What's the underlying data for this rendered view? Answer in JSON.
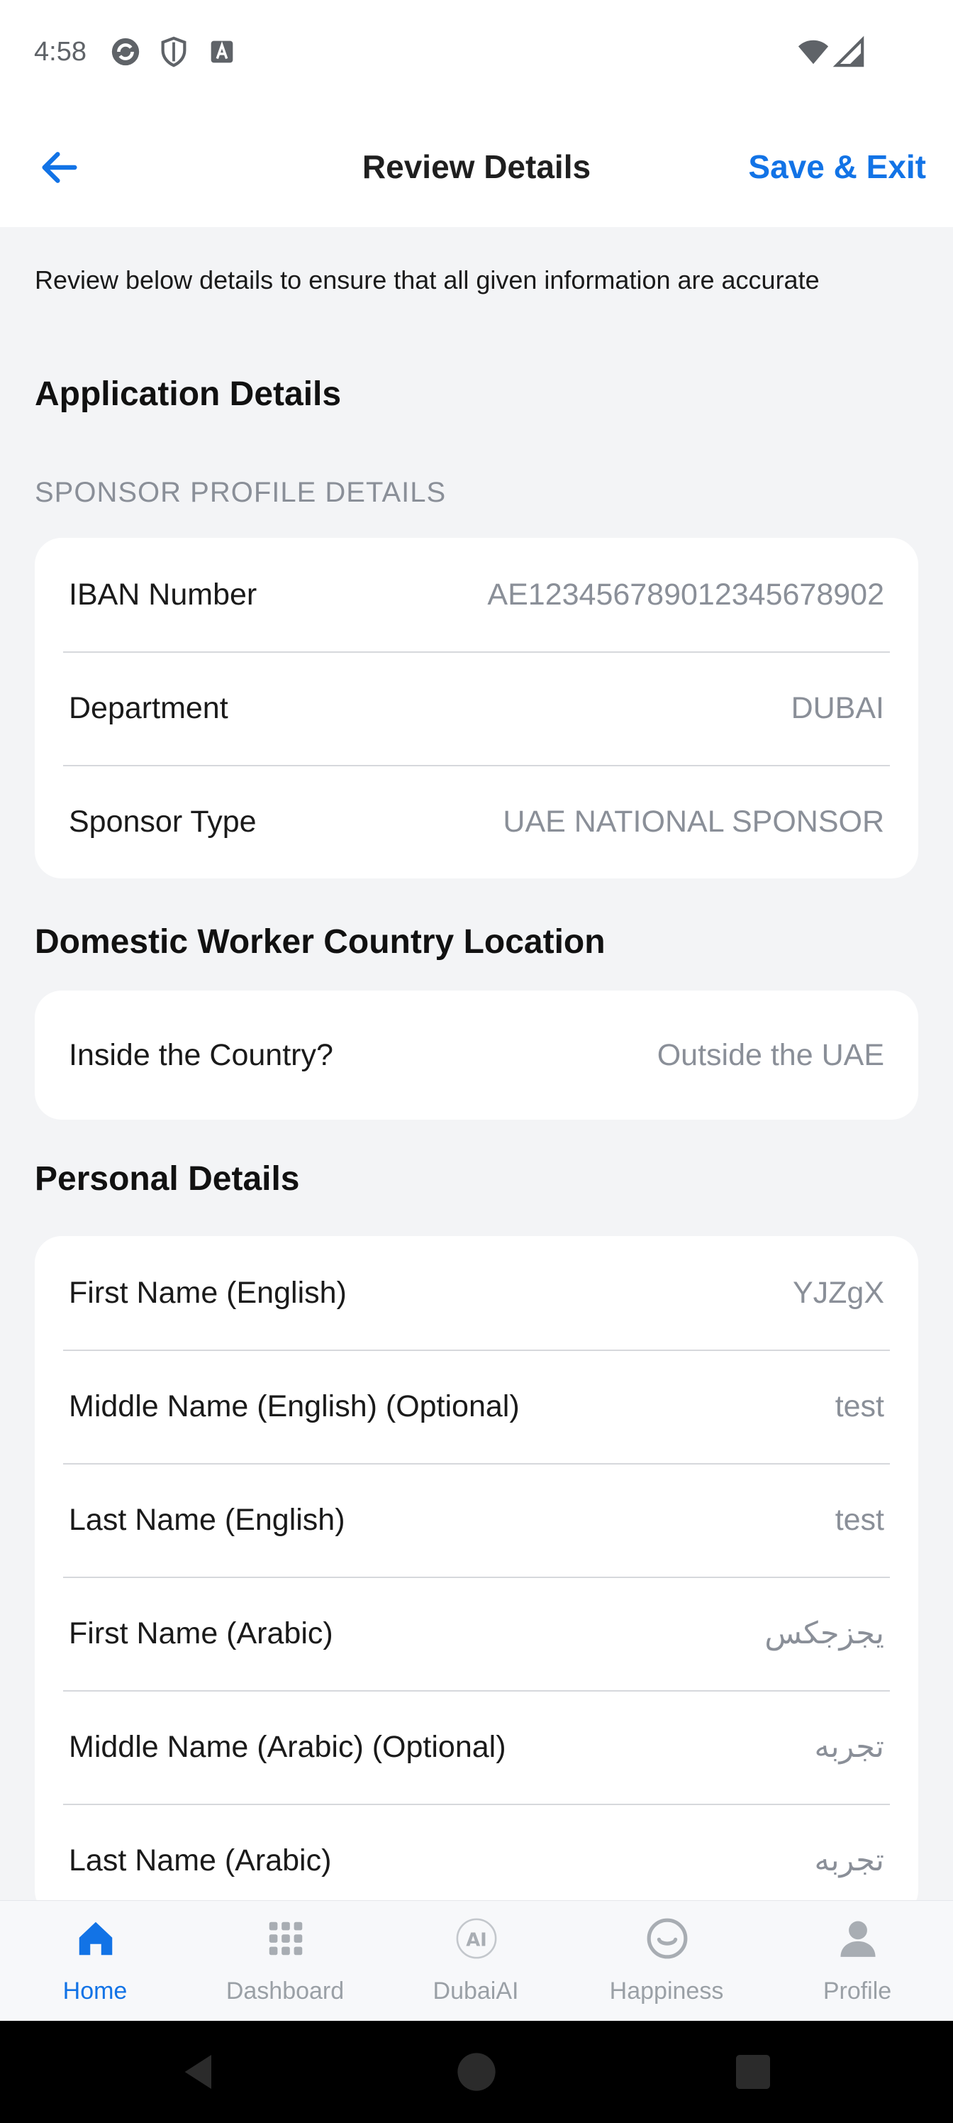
{
  "status_bar": {
    "time": "4:58",
    "icons": [
      "sync-icon",
      "shield-icon",
      "font-icon",
      "wifi-icon",
      "signal-icon"
    ]
  },
  "header": {
    "title": "Review Details",
    "save_label": "Save & Exit",
    "accent_color": "#1273e6"
  },
  "intro_text": "Review below details to ensure that all given information are accurate",
  "application": {
    "title": "Application Details",
    "sponsor_subtitle": "SPONSOR PROFILE DETAILS",
    "sponsor_rows": [
      {
        "label": "IBAN Number",
        "value": "AE123456789012345678902"
      },
      {
        "label": "Department",
        "value": "DUBAI"
      },
      {
        "label": "Sponsor Type",
        "value": "UAE NATIONAL SPONSOR"
      }
    ]
  },
  "location": {
    "title": "Domestic Worker Country Location",
    "rows": [
      {
        "label": "Inside the Country?",
        "value": "Outside the UAE"
      }
    ]
  },
  "personal": {
    "title": "Personal Details",
    "rows": [
      {
        "label": "First Name (English)",
        "value": "YJZgX"
      },
      {
        "label": "Middle Name (English) (Optional)",
        "value": "test"
      },
      {
        "label": "Last Name (English)",
        "value": "test"
      },
      {
        "label": "First Name (Arabic)",
        "value": "يجزجكس"
      },
      {
        "label": "Middle Name (Arabic) (Optional)",
        "value": "تجربه"
      },
      {
        "label": "Last Name (Arabic)",
        "value": "تجربه"
      }
    ]
  },
  "bottom_nav": {
    "items": [
      {
        "label": "Home",
        "icon": "home-icon",
        "active": true
      },
      {
        "label": "Dashboard",
        "icon": "grid-icon",
        "active": false
      },
      {
        "label": "DubaiAI",
        "icon": "ai-icon",
        "active": false
      },
      {
        "label": "Happiness",
        "icon": "smile-icon",
        "active": false
      },
      {
        "label": "Profile",
        "icon": "person-icon",
        "active": false
      }
    ]
  }
}
